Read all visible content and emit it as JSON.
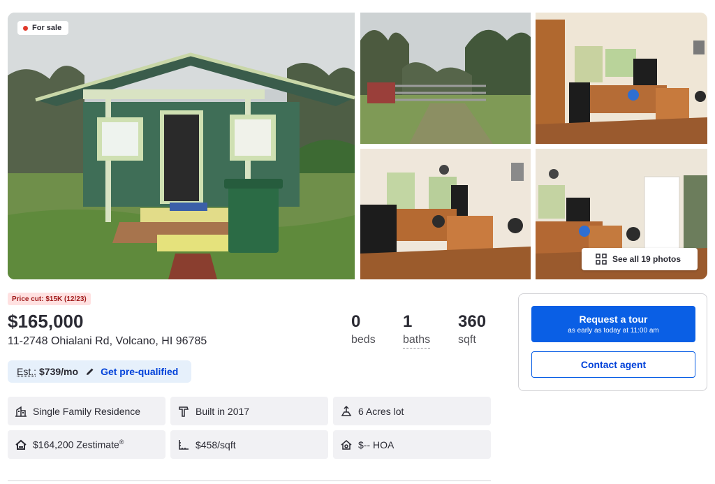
{
  "gallery": {
    "badge": "For sale",
    "see_all_label": "See all 19 photos",
    "photos": [
      {
        "name": "main-house-photo"
      },
      {
        "name": "gate-photo"
      },
      {
        "name": "kitchen-photo-1"
      },
      {
        "name": "kitchen-photo-2"
      },
      {
        "name": "kitchen-photo-3"
      }
    ]
  },
  "summary": {
    "price_cut": "Price cut: $15K (12/23)",
    "price": "$165,000",
    "address": "11-2748 Ohialani Rd, Volcano, HI 96785",
    "stats": {
      "beds": {
        "value": "0",
        "label": "beds"
      },
      "baths": {
        "value": "1",
        "label": "baths"
      },
      "sqft": {
        "value": "360",
        "label": "sqft"
      }
    },
    "estimate": {
      "label": "Est.:",
      "amount": "$739/mo",
      "cta": "Get pre-qualified"
    }
  },
  "facts": {
    "type": "Single Family Residence",
    "built": "Built in 2017",
    "lot": "6 Acres lot",
    "zestimate": "$164,200 Zestimate",
    "zestimate_mark": "®",
    "price_per_sqft": "$458/sqft",
    "hoa": "$-- HOA"
  },
  "actions": {
    "tour_label": "Request a tour",
    "tour_sub": "as early as today at 11:00 am",
    "contact_label": "Contact agent"
  },
  "colors": {
    "primary": "#0a5fe5",
    "link": "#0041d9",
    "price_cut_bg": "#ffe1e1",
    "price_cut_text": "#a11b1b",
    "chip_bg": "#f1f1f4",
    "house_green": "#3f6e57"
  },
  "icons": [
    "building-icon",
    "hammer-icon",
    "lot-icon",
    "zestimate-icon",
    "ruler-icon",
    "hoa-icon",
    "grid-icon",
    "pencil-icon"
  ]
}
